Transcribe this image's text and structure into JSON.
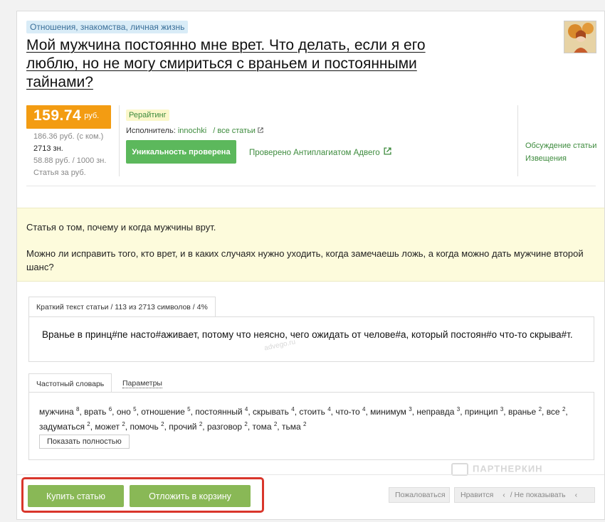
{
  "article": {
    "category": "Отношения, знакомства, личная жизнь",
    "title": "Мой мужчина постоянно мне врет. Что делать, если я его люблю, но не могу смириться с враньем и постоянными тайнами?"
  },
  "price": {
    "main": "159.74",
    "currency": "руб.",
    "with_commission": "186.36 руб. (с ком.)",
    "chars": "2713 зн.",
    "per_1000": "58.88 руб. / 1000 зн.",
    "per_rub": "Статья за руб."
  },
  "meta": {
    "type_tag": "Рерайтинг",
    "executor_label": "Исполнитель:",
    "executor_name": "innochki",
    "all_articles": "/ все статьи",
    "uniqueness_button": "Уникальность проверена",
    "antiplagiat_link": "Проверено Антиплагиатом Адвего",
    "discussion_link": "Обсуждение статьи",
    "notifications_link": "Извещения"
  },
  "description": {
    "p1": "Статья о том, почему и когда мужчины врут.",
    "p2": "Можно ли исправить того, кто врет, и в каких случаях нужно уходить, когда замечаешь ложь, а когда можно дать мужчине второй шанс?"
  },
  "short_text": {
    "tab_label": "Краткий текст статьи / 113 из 2713 символов / 4%",
    "text": "Вранье в принц#пе насто#аживает, потому что неясно, чего ожидать от челове#а, который постоян#о что-то скрыва#т."
  },
  "frequency": {
    "tab_label": "Частотный словарь",
    "params_tab": "Параметры",
    "words": [
      {
        "word": "мужчина",
        "count": "8"
      },
      {
        "word": "врать",
        "count": "6"
      },
      {
        "word": "оно",
        "count": "5"
      },
      {
        "word": "отношение",
        "count": "5"
      },
      {
        "word": "постоянный",
        "count": "4"
      },
      {
        "word": "скрывать",
        "count": "4"
      },
      {
        "word": "стоить",
        "count": "4"
      },
      {
        "word": "что-то",
        "count": "4"
      },
      {
        "word": "минимум",
        "count": "3"
      },
      {
        "word": "неправда",
        "count": "3"
      },
      {
        "word": "принцип",
        "count": "3"
      },
      {
        "word": "вранье",
        "count": "2"
      },
      {
        "word": "все",
        "count": "2"
      },
      {
        "word": "задуматься",
        "count": "2"
      },
      {
        "word": "может",
        "count": "2"
      },
      {
        "word": "помочь",
        "count": "2"
      },
      {
        "word": "прочий",
        "count": "2"
      },
      {
        "word": "разговор",
        "count": "2"
      },
      {
        "word": "тома",
        "count": "2"
      },
      {
        "word": "тьма",
        "count": "2"
      }
    ],
    "show_full_button": "Показать полностью"
  },
  "actions": {
    "buy": "Купить статью",
    "defer": "Отложить в корзину",
    "complain": "Пожаловаться",
    "like": "Нравится",
    "hide": "/ Не показывать"
  },
  "watermark": "ПАРТНЕРКИН"
}
